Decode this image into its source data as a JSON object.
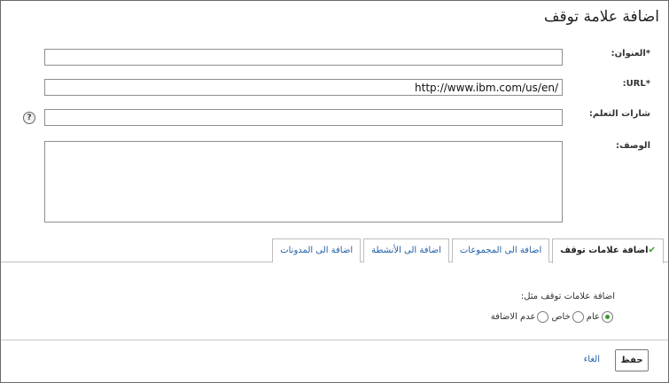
{
  "dialog": {
    "title": "اضافة علامة توقف"
  },
  "form": {
    "title_label": "العنوان:",
    "title_required": "*",
    "title_value": "",
    "url_label": "URL:",
    "url_required": "*",
    "url_value": "http://www.ibm.com/us/en/",
    "tags_label": "شارات التعلم:",
    "tags_value": "",
    "help_icon_text": "?",
    "description_label": "الوصف:",
    "description_value": ""
  },
  "tabs": [
    {
      "label": "اضافة علامات توقف",
      "active": true,
      "check": "✔"
    },
    {
      "label": "اضافة الى المجموعات",
      "active": false
    },
    {
      "label": "اضافة الى الأنشطة",
      "active": false
    },
    {
      "label": "اضافة الى المدونات",
      "active": false
    }
  ],
  "bookmark_panel": {
    "label": "اضافة علامات توقف مثل:",
    "options": [
      {
        "label": "عام",
        "selected": true
      },
      {
        "label": "خاص",
        "selected": false
      },
      {
        "label": "عدم الاضافة",
        "selected": false
      }
    ]
  },
  "footer": {
    "save_label": "حفظ",
    "cancel_label": "الغاء"
  },
  "colors": {
    "link": "#2360a8",
    "check": "#3a9a2a",
    "border": "#8e8e8e"
  }
}
